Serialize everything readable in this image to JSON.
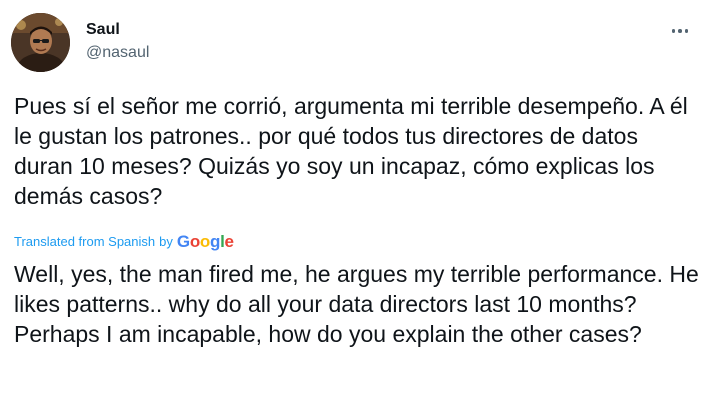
{
  "author": {
    "display_name": "Saul",
    "handle": "@nasaul"
  },
  "tweet": {
    "original_text": "Pues sí el señor me corrió, argumenta mi terrible desempeño. A él le gustan los patrones.. por qué todos tus directores de datos duran 10 meses? Quizás yo soy un incapaz, cómo explicas los demás casos?",
    "translated_from_label": "Translated from Spanish",
    "by_label": "by",
    "translator_logo": "Google",
    "translation_text": "Well, yes, the man fired me, he argues my terrible performance. He likes patterns.. why do all your data directors last 10 months? Perhaps I am incapable, how do you explain the other cases?"
  },
  "icons": {
    "more": "more-horizontal-icon",
    "avatar": "profile-photo"
  },
  "colors": {
    "text_primary": "#0f1419",
    "text_secondary": "#536471",
    "link_blue": "#1d9bf0"
  }
}
